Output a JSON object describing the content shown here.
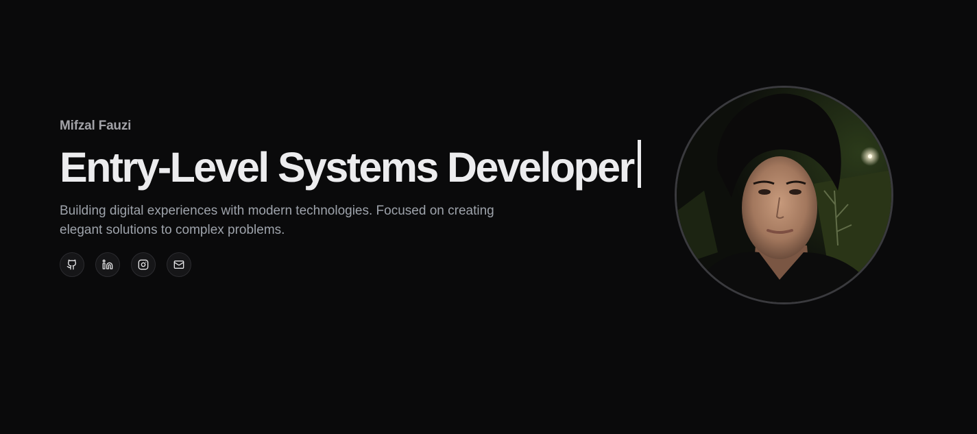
{
  "hero": {
    "name": "Mifzal Fauzi",
    "title": "Entry-Level Systems Developer",
    "description": "Building digital experiences with modern technologies. Focused on creating elegant solutions to complex problems."
  },
  "socials": [
    {
      "icon": "github-icon"
    },
    {
      "icon": "linkedin-icon"
    },
    {
      "icon": "instagram-icon"
    },
    {
      "icon": "mail-icon"
    }
  ],
  "colors": {
    "background": "#0a0a0b",
    "title": "#ececee",
    "name": "#a3a3a8",
    "description": "#9ea3ab",
    "avatar_border": "#3a3a3e"
  }
}
